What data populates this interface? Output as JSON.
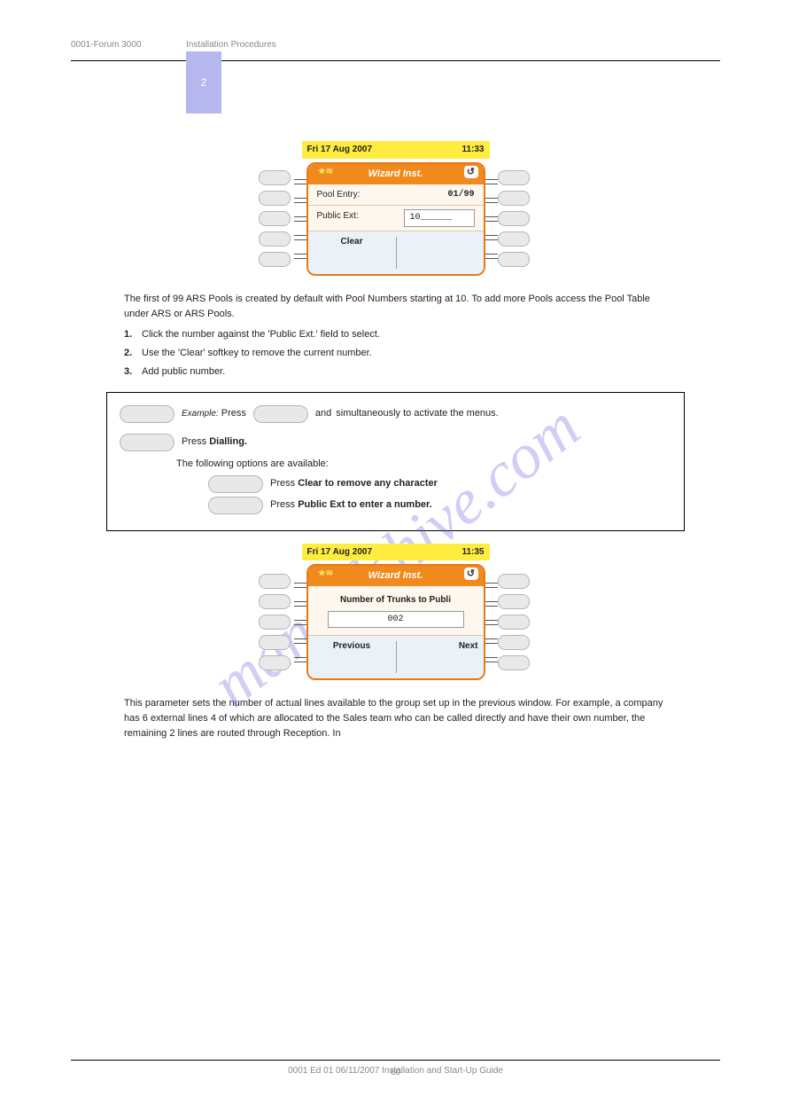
{
  "header": {
    "left": "0001-Forum 3000",
    "right": "Installation Procedures",
    "tab": "2"
  },
  "watermark": "manualshive.com",
  "screen1": {
    "date": "Fri 17 Aug 2007",
    "time": "11:33",
    "title": "Wizard Inst.",
    "row1_label": "Pool Entry:",
    "row1_value": "01/99",
    "row2_label": "Public Ext:",
    "row2_value": "10______",
    "soft_left": "Clear"
  },
  "para1": "The first of 99 ARS Pools is created by default with Pool Numbers starting at 10. To add more Pools access the Pool Table under ARS or ARS Pools.",
  "list": [
    "Click the number against the 'Public Ext.' field to select.",
    "Use the 'Clear' softkey to remove the current number.",
    "Add public number."
  ],
  "example": {
    "label": "Example:",
    "step1_a": "Press",
    "step1_b": "and",
    "step1_c": "simultaneously to activate the menus.",
    "step2_a": "Press",
    "step2_b": "Dialling.",
    "step3": "The following options are available:",
    "opt1_a": "Press",
    "opt1_b": "Clear to remove any character",
    "opt2_a": "Press",
    "opt2_b": "Public Ext to enter a number."
  },
  "screen2": {
    "date": "Fri 17 Aug 2007",
    "time": "11:35",
    "title": "Wizard Inst.",
    "row_label": "Number of Trunks to Publi",
    "row_value": "002",
    "soft_left": "Previous",
    "soft_right": "Next"
  },
  "para2": "This parameter sets the number of actual lines available to the group set up in the previous window. For example, a company has 6 external lines 4 of which are allocated to the Sales team who can be called directly and have their own number, the remaining 2 lines are routed through Reception. In",
  "footer": {
    "text": "0001 Ed 01   06/11/2007   Installation and Start-Up Guide",
    "page": "60"
  }
}
